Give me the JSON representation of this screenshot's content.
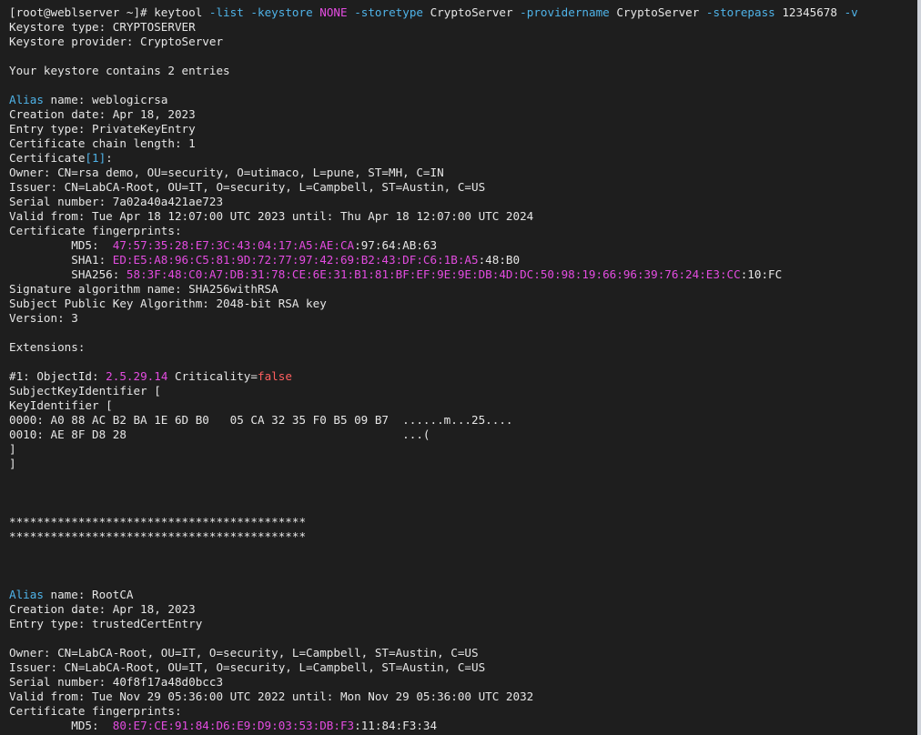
{
  "terminal": {
    "lines": [
      [
        {
          "t": "[root@weblserver ~]# keytool ",
          "c": "default"
        },
        {
          "t": "-list",
          "c": "cyan"
        },
        {
          "t": " ",
          "c": "default"
        },
        {
          "t": "-keystore",
          "c": "cyan"
        },
        {
          "t": " ",
          "c": "default"
        },
        {
          "t": "NONE",
          "c": "mag"
        },
        {
          "t": " ",
          "c": "default"
        },
        {
          "t": "-storetype",
          "c": "cyan"
        },
        {
          "t": " CryptoServer ",
          "c": "default"
        },
        {
          "t": "-providername",
          "c": "cyan"
        },
        {
          "t": " CryptoServer ",
          "c": "default"
        },
        {
          "t": "-storepass",
          "c": "cyan"
        },
        {
          "t": " 12345678 ",
          "c": "default"
        },
        {
          "t": "-v",
          "c": "cyan"
        }
      ],
      [
        {
          "t": "Keystore type: CRYPTOSERVER",
          "c": "default"
        }
      ],
      [
        {
          "t": "Keystore provider: CryptoServer",
          "c": "default"
        }
      ],
      [],
      [
        {
          "t": "Your keystore contains 2 entries",
          "c": "default"
        }
      ],
      [],
      [
        {
          "t": "Alias",
          "c": "cyan"
        },
        {
          "t": " name: weblogicrsa",
          "c": "default"
        }
      ],
      [
        {
          "t": "Creation date: Apr 18, 2023",
          "c": "default"
        }
      ],
      [
        {
          "t": "Entry type: PrivateKeyEntry",
          "c": "default"
        }
      ],
      [
        {
          "t": "Certificate chain length: 1",
          "c": "default"
        }
      ],
      [
        {
          "t": "Certificate",
          "c": "default"
        },
        {
          "t": "[1]",
          "c": "cyan"
        },
        {
          "t": ":",
          "c": "default"
        }
      ],
      [
        {
          "t": "Owner: CN=rsa demo, OU=security, O=utimaco, L=pune, ST=MH, C=IN",
          "c": "default"
        }
      ],
      [
        {
          "t": "Issuer: CN=LabCA-Root, OU=IT, O=security, L=Campbell, ST=Austin, C=US",
          "c": "default"
        }
      ],
      [
        {
          "t": "Serial number: 7a02a40a421ae723",
          "c": "default"
        }
      ],
      [
        {
          "t": "Valid from: Tue Apr 18 12:07:00 UTC 2023 until: Thu Apr 18 12:07:00 UTC 2024",
          "c": "default"
        }
      ],
      [
        {
          "t": "Certificate fingerprints:",
          "c": "default"
        }
      ],
      [
        {
          "t": "         MD5:  ",
          "c": "default"
        },
        {
          "t": "47:57:35:28:E7:3C:43:04:17:A5:AE:CA",
          "c": "mag"
        },
        {
          "t": ":97:64:AB:63",
          "c": "default"
        }
      ],
      [
        {
          "t": "         SHA1: ",
          "c": "default"
        },
        {
          "t": "ED:E5:A8:96:C5:81:9D:72:77:97:42:69:B2:43:DF:C6:1B:A5",
          "c": "mag"
        },
        {
          "t": ":48:B0",
          "c": "default"
        }
      ],
      [
        {
          "t": "         SHA256: ",
          "c": "default"
        },
        {
          "t": "58:3F:48:C0:A7:DB:31:78:CE:6E:31:B1:81:BF:EF:9E:9E:DB:4D:DC:50:98:19:66:96:39:76:24:E3:CC",
          "c": "mag"
        },
        {
          "t": ":10:FC",
          "c": "default"
        }
      ],
      [
        {
          "t": "Signature algorithm name: SHA256withRSA",
          "c": "default"
        }
      ],
      [
        {
          "t": "Subject Public Key Algorithm: 2048-bit RSA key",
          "c": "default"
        }
      ],
      [
        {
          "t": "Version: 3",
          "c": "default"
        }
      ],
      [],
      [
        {
          "t": "Extensions:",
          "c": "default"
        }
      ],
      [],
      [
        {
          "t": "#1: ObjectId: ",
          "c": "default"
        },
        {
          "t": "2.5.29.14",
          "c": "mag"
        },
        {
          "t": " Criticality=",
          "c": "default"
        },
        {
          "t": "false",
          "c": "red"
        }
      ],
      [
        {
          "t": "SubjectKeyIdentifier [",
          "c": "default"
        }
      ],
      [
        {
          "t": "KeyIdentifier [",
          "c": "default"
        }
      ],
      [
        {
          "t": "0000: A0 88 AC B2 BA 1E 6D B0   05 CA 32 35 F0 B5 09 B7  ......m...25....",
          "c": "default"
        }
      ],
      [
        {
          "t": "0010: AE 8F D8 28                                        ...(",
          "c": "default"
        }
      ],
      [
        {
          "t": "]",
          "c": "default"
        }
      ],
      [
        {
          "t": "]",
          "c": "default"
        }
      ],
      [],
      [],
      [],
      [
        {
          "t": "*******************************************",
          "c": "default"
        }
      ],
      [
        {
          "t": "*******************************************",
          "c": "default"
        }
      ],
      [],
      [],
      [],
      [
        {
          "t": "Alias",
          "c": "cyan"
        },
        {
          "t": " name: RootCA",
          "c": "default"
        }
      ],
      [
        {
          "t": "Creation date: Apr 18, 2023",
          "c": "default"
        }
      ],
      [
        {
          "t": "Entry type: trustedCertEntry",
          "c": "default"
        }
      ],
      [],
      [
        {
          "t": "Owner: CN=LabCA-Root, OU=IT, O=security, L=Campbell, ST=Austin, C=US",
          "c": "default"
        }
      ],
      [
        {
          "t": "Issuer: CN=LabCA-Root, OU=IT, O=security, L=Campbell, ST=Austin, C=US",
          "c": "default"
        }
      ],
      [
        {
          "t": "Serial number: 40f8f17a48d0bcc3",
          "c": "default"
        }
      ],
      [
        {
          "t": "Valid from: Tue Nov 29 05:36:00 UTC 2022 until: Mon Nov 29 05:36:00 UTC 2032",
          "c": "default"
        }
      ],
      [
        {
          "t": "Certificate fingerprints:",
          "c": "default"
        }
      ],
      [
        {
          "t": "         MD5:  ",
          "c": "default"
        },
        {
          "t": "80:E7:CE:91:84:D6:E9:D9:03:53:DB:F3",
          "c": "mag"
        },
        {
          "t": ":11:84:F3:34",
          "c": "default"
        }
      ]
    ]
  }
}
